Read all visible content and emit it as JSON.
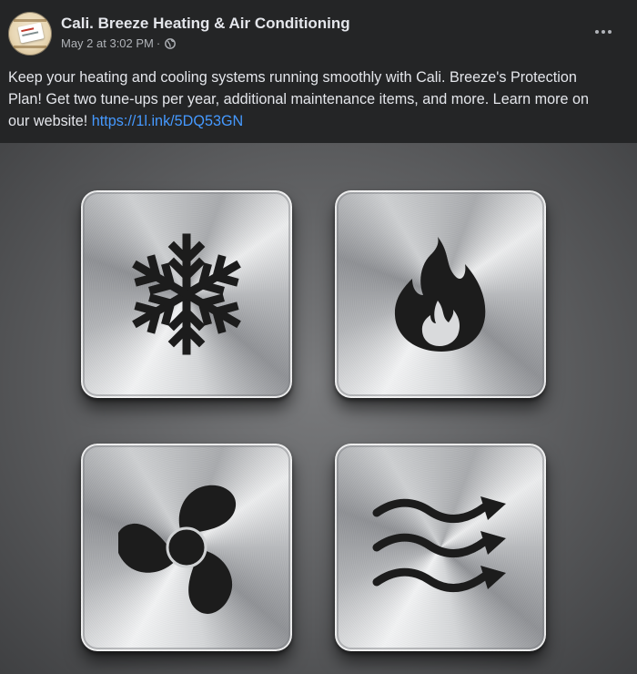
{
  "post": {
    "page_name": "Cali. Breeze Heating & Air Conditioning",
    "timestamp": "May 2 at 3:02 PM",
    "separator": "·",
    "audience_icon": "globe-icon",
    "more_icon": "more-horizontal-icon",
    "text_before_link": "Keep your heating and cooling systems running smoothly with Cali. Breeze's Protection Plan! Get two tune-ups per year, additional maintenance items, and more. Learn more on our website! ",
    "link_text": "https://1l.ink/5DQ53GN"
  },
  "image": {
    "tiles": [
      {
        "icon": "snowflake-icon"
      },
      {
        "icon": "flame-icon"
      },
      {
        "icon": "fan-icon"
      },
      {
        "icon": "airflow-icon"
      }
    ]
  },
  "colors": {
    "background": "#242526",
    "text": "#e4e6eb",
    "secondary_text": "#b0b3b8",
    "link": "#4599ff",
    "icon_fill": "#1c1c1c"
  }
}
